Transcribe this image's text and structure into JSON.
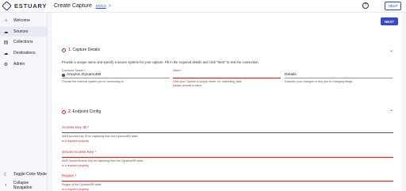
{
  "brand": {
    "name": "ESTUARY"
  },
  "header": {
    "title": "Create Capture",
    "docs_label": "DOCS",
    "help_label": "HELP"
  },
  "sidebar": {
    "items": [
      {
        "label": "Welcome",
        "icon": "home-icon"
      },
      {
        "label": "Sources",
        "icon": "cloud-upload-icon"
      },
      {
        "label": "Collections",
        "icon": "database-icon"
      },
      {
        "label": "Destinations",
        "icon": "cloud-download-icon"
      },
      {
        "label": "Admin",
        "icon": "gear-icon"
      }
    ],
    "toggle_color_mode": "Toggle Color Mode",
    "collapse_navigation": "Collapse Navigation"
  },
  "main": {
    "next_label": "NEXT",
    "capture_details": {
      "title": "1. Capture Details",
      "description": "Provide a unique name and specify a source system for your capture. Fill in the required details and click \"Next\" to test the connection.",
      "connector": {
        "label": "Connector Search *",
        "value": "Amazon DynamoDB",
        "helper": "Choose the external system you're connecting to."
      },
      "name": {
        "label": "Name *",
        "value": "",
        "helper": "Give your Capture a unique name, ex: marketing_data",
        "error": "please provide a name"
      },
      "details": {
        "label": "Details",
        "value": "",
        "helper": "Describe your changes or why you're changing things."
      }
    },
    "endpoint_config": {
      "title": "2. Endpoint Config",
      "fields": [
        {
          "label": "Access Key ID *",
          "helper": "AWS Access Key ID for capturing from the DynamoDB table.",
          "error": "is a required property"
        },
        {
          "label": "Secret Access Key *",
          "helper": "AWS Secret Access Key for capturing from the DynamoDB table.",
          "error": "is a required property"
        },
        {
          "label": "Region *",
          "helper": "Region of the DynamoDB table",
          "error": "is a required property"
        }
      ]
    }
  }
}
